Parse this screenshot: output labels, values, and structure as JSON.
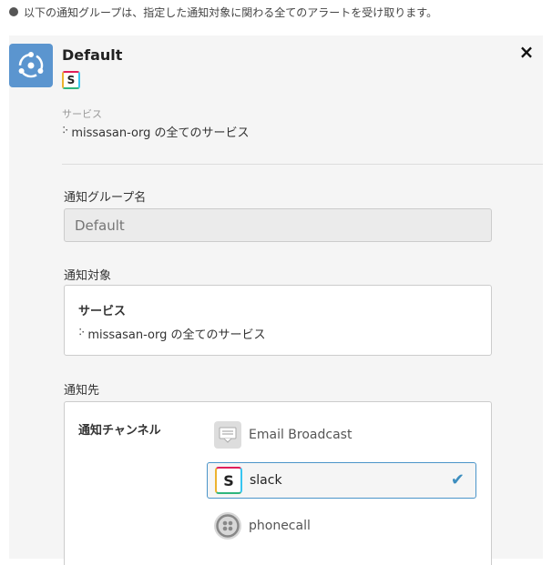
{
  "notice": {
    "text": "以下の通知グループは、指定した通知対象に関わる全てのアラートを受け取ります。"
  },
  "group": {
    "title": "Default",
    "service_label": "サービス",
    "service_value": "missasan-org の全てのサービス"
  },
  "form": {
    "name_label": "通知グループ名",
    "name_placeholder": "Default",
    "target_label": "通知対象",
    "target_title": "サービス",
    "target_value": "missasan-org の全てのサービス",
    "destination_label": "通知先",
    "channel_label": "通知チャンネル",
    "channels": [
      {
        "label": "Email Broadcast",
        "icon": "email-icon",
        "selected": false
      },
      {
        "label": "slack",
        "icon": "slack-icon",
        "selected": true
      },
      {
        "label": "phonecall",
        "icon": "phone-icon",
        "selected": false
      }
    ]
  },
  "icons": {
    "close": "×",
    "check": "✔",
    "service": "⠕",
    "slack_letter": "S"
  },
  "colors": {
    "accent": "#4a94c9",
    "group_icon_bg": "#5b95cf"
  }
}
